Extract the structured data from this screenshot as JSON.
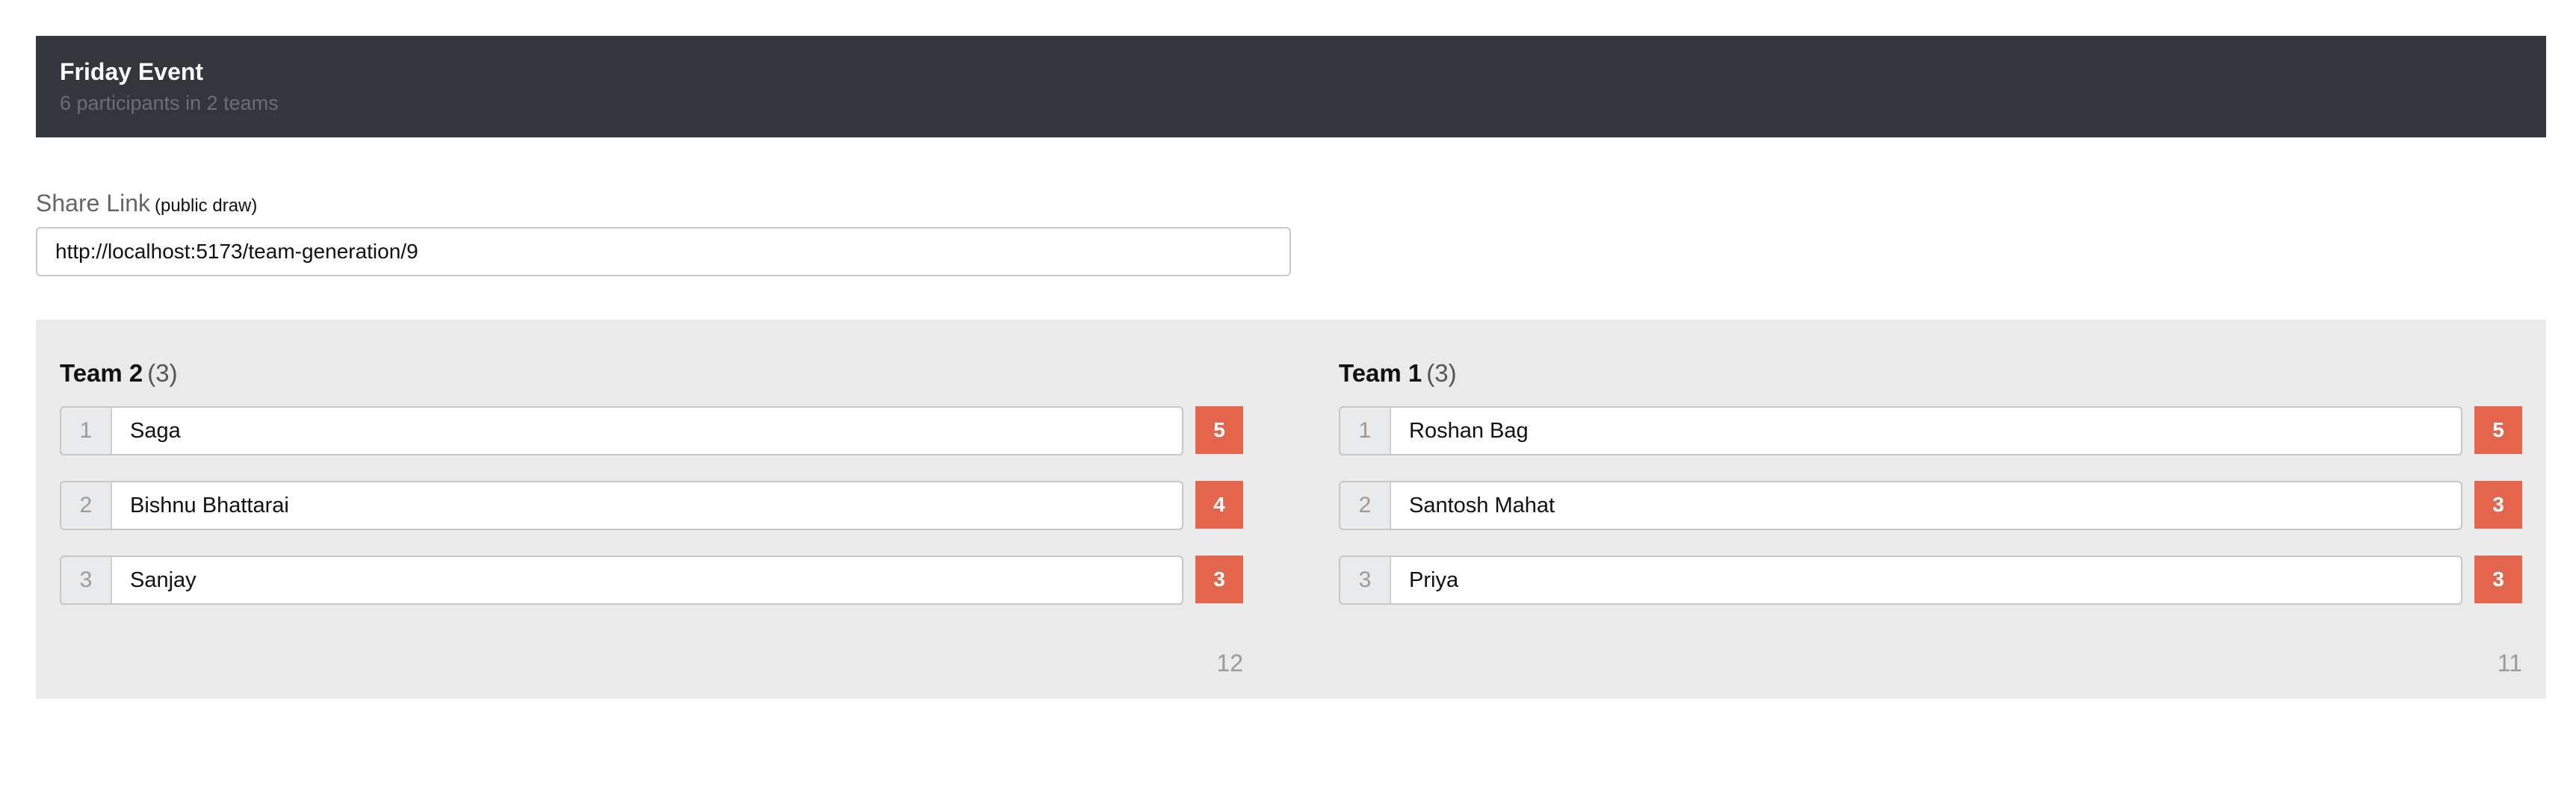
{
  "header": {
    "title": "Friday Event",
    "subtitle": "6 participants in 2 teams"
  },
  "share": {
    "label": "Share Link",
    "hint": "(public draw)",
    "value": "http://localhost:5173/team-generation/9"
  },
  "teams": [
    {
      "name": "Team 2",
      "count": "(3)",
      "members": [
        {
          "index": "1",
          "name": "Saga",
          "score": "5"
        },
        {
          "index": "2",
          "name": "Bishnu Bhattarai",
          "score": "4"
        },
        {
          "index": "3",
          "name": "Sanjay",
          "score": "3"
        }
      ],
      "total": "12"
    },
    {
      "name": "Team 1",
      "count": "(3)",
      "members": [
        {
          "index": "1",
          "name": "Roshan Bag",
          "score": "5"
        },
        {
          "index": "2",
          "name": "Santosh Mahat",
          "score": "3"
        },
        {
          "index": "3",
          "name": "Priya",
          "score": "3"
        }
      ],
      "total": "11"
    }
  ],
  "colors": {
    "header_bg": "#33363b",
    "score_bg": "#e4654e",
    "panel_bg": "#eaeaea"
  }
}
